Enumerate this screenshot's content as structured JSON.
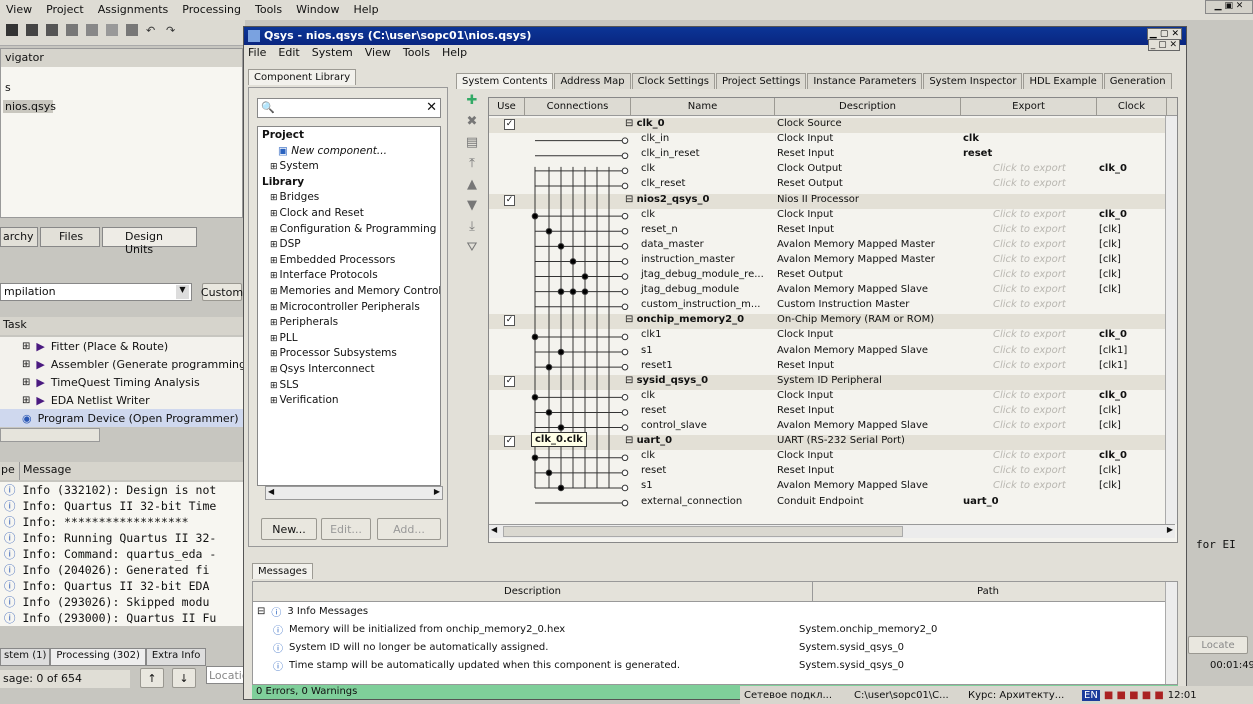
{
  "bg": {
    "menu": [
      "View",
      "Project",
      "Assignments",
      "Processing",
      "Tools",
      "Window",
      "Help"
    ],
    "navigator_label": "vigator",
    "nav_letter": "s",
    "file_item": "nios.qsys",
    "nav_tabs": [
      "archy",
      "Files",
      "Design Units"
    ],
    "compile_select": "mpilation",
    "custom_btn": "Custom",
    "task_header": "Task",
    "tasks": [
      "Fitter (Place & Route)",
      "Assembler (Generate programming fil",
      "TimeQuest Timing Analysis",
      "EDA Netlist Writer",
      "Program Device (Open Programmer)"
    ],
    "msg_col1": "pe",
    "msg_col2": "Message",
    "logs": [
      "Info (332102): Design is not",
      "Info: Quartus II 32-bit Time",
      "Info: ******************",
      "Info: Running Quartus II 32-",
      "Info: Command: quartus_eda -",
      "Info (204026): Generated fi",
      "Info: Quartus II 32-bit EDA",
      "Info (293026): Skipped modu",
      "Info (293000): Quartus II Fu"
    ],
    "bottom_tabs": [
      "stem (1)",
      "Processing (302)",
      "Extra Info"
    ],
    "status": "sage: 0 of 654",
    "location": "Locatio",
    "right_text": "for EI",
    "right_locate": "Locate",
    "right_time": "00:01:49"
  },
  "qsys": {
    "title": "Qsys - nios.qsys (C:\\user\\sopc01\\nios.qsys)",
    "menu": [
      "File",
      "Edit",
      "System",
      "View",
      "Tools",
      "Help"
    ],
    "lib_tab": "Component Library",
    "lib": [
      {
        "t": "Project",
        "b": true,
        "i": 0
      },
      {
        "t": "New component...",
        "i": 2,
        "it": true
      },
      {
        "t": "System",
        "i": 1,
        "p": true
      },
      {
        "t": "Library",
        "b": true,
        "i": 0
      },
      {
        "t": "Bridges",
        "i": 1,
        "p": true
      },
      {
        "t": "Clock and Reset",
        "i": 1,
        "p": true
      },
      {
        "t": "Configuration & Programming",
        "i": 1,
        "p": true
      },
      {
        "t": "DSP",
        "i": 1,
        "p": true
      },
      {
        "t": "Embedded Processors",
        "i": 1,
        "p": true
      },
      {
        "t": "Interface Protocols",
        "i": 1,
        "p": true
      },
      {
        "t": "Memories and Memory Controller",
        "i": 1,
        "p": true
      },
      {
        "t": "Microcontroller Peripherals",
        "i": 1,
        "p": true
      },
      {
        "t": "Peripherals",
        "i": 1,
        "p": true
      },
      {
        "t": "PLL",
        "i": 1,
        "p": true
      },
      {
        "t": "Processor Subsystems",
        "i": 1,
        "p": true
      },
      {
        "t": "Qsys Interconnect",
        "i": 1,
        "p": true
      },
      {
        "t": "SLS",
        "i": 1,
        "p": true
      },
      {
        "t": "Verification",
        "i": 1,
        "p": true
      }
    ],
    "lib_buttons": [
      "New...",
      "Edit...",
      "Add..."
    ],
    "tabs": [
      "System Contents",
      "Address Map",
      "Clock Settings",
      "Project Settings",
      "Instance Parameters",
      "System Inspector",
      "HDL Example",
      "Generation"
    ],
    "cols": [
      "Use",
      "Connections",
      "Name",
      "Description",
      "Export",
      "Clock"
    ],
    "rows": [
      {
        "use": "✓",
        "name": "clk_0",
        "desc": "Clock Source",
        "exp": "",
        "clk": "",
        "top": true
      },
      {
        "name": "clk_in",
        "desc": "Clock Input",
        "exp": "clk",
        "clk": ""
      },
      {
        "name": "clk_in_reset",
        "desc": "Reset Input",
        "exp": "reset",
        "clk": ""
      },
      {
        "name": "clk",
        "desc": "Clock Output",
        "exp": "Click to export",
        "clk": "clk_0"
      },
      {
        "name": "clk_reset",
        "desc": "Reset Output",
        "exp": "Click to export",
        "clk": ""
      },
      {
        "use": "✓",
        "name": "nios2_qsys_0",
        "desc": "Nios II Processor",
        "exp": "",
        "clk": "",
        "top": true
      },
      {
        "name": "clk",
        "desc": "Clock Input",
        "exp": "Click to export",
        "clk": "clk_0"
      },
      {
        "name": "reset_n",
        "desc": "Reset Input",
        "exp": "Click to export",
        "clk": "[clk]"
      },
      {
        "name": "data_master",
        "desc": "Avalon Memory Mapped Master",
        "exp": "Click to export",
        "clk": "[clk]"
      },
      {
        "name": "instruction_master",
        "desc": "Avalon Memory Mapped Master",
        "exp": "Click to export",
        "clk": "[clk]"
      },
      {
        "name": "jtag_debug_module_re...",
        "desc": "Reset Output",
        "exp": "Click to export",
        "clk": "[clk]"
      },
      {
        "name": "jtag_debug_module",
        "desc": "Avalon Memory Mapped Slave",
        "exp": "Click to export",
        "clk": "[clk]"
      },
      {
        "name": "custom_instruction_m...",
        "desc": "Custom Instruction Master",
        "exp": "Click to export",
        "clk": ""
      },
      {
        "use": "✓",
        "name": "onchip_memory2_0",
        "desc": "On-Chip Memory (RAM or ROM)",
        "exp": "",
        "clk": "",
        "top": true
      },
      {
        "name": "clk1",
        "desc": "Clock Input",
        "exp": "Click to export",
        "clk": "clk_0"
      },
      {
        "name": "s1",
        "desc": "Avalon Memory Mapped Slave",
        "exp": "Click to export",
        "clk": "[clk1]"
      },
      {
        "name": "reset1",
        "desc": "Reset Input",
        "exp": "Click to export",
        "clk": "[clk1]"
      },
      {
        "use": "✓",
        "name": "sysid_qsys_0",
        "desc": "System ID Peripheral",
        "exp": "",
        "clk": "",
        "top": true
      },
      {
        "name": "clk",
        "desc": "Clock Input",
        "exp": "Click to export",
        "clk": "clk_0"
      },
      {
        "name": "reset",
        "desc": "Reset Input",
        "exp": "Click to export",
        "clk": "[clk]"
      },
      {
        "name": "control_slave",
        "desc": "Avalon Memory Mapped Slave",
        "exp": "Click to export",
        "clk": "[clk]"
      },
      {
        "use": "✓",
        "name": "uart_0",
        "desc": "UART (RS-232 Serial Port)",
        "exp": "",
        "clk": "",
        "top": true
      },
      {
        "name": "clk",
        "desc": "Clock Input",
        "exp": "Click to export",
        "clk": "clk_0"
      },
      {
        "name": "reset",
        "desc": "Reset Input",
        "exp": "Click to export",
        "clk": "[clk]"
      },
      {
        "name": "s1",
        "desc": "Avalon Memory Mapped Slave",
        "exp": "Click to export",
        "clk": "[clk]"
      },
      {
        "name": "external_connection",
        "desc": "Conduit Endpoint",
        "exp": "uart_0",
        "clk": ""
      }
    ],
    "tooltip": "clk_0.clk",
    "messages_tab": "Messages",
    "msg_cols": [
      "Description",
      "Path"
    ],
    "msg_rows": [
      {
        "d": "3 Info Messages",
        "p": "",
        "group": true
      },
      {
        "d": "Memory will be initialized from onchip_memory2_0.hex",
        "p": "System.onchip_memory2_0"
      },
      {
        "d": "System ID will no longer be automatically assigned.",
        "p": "System.sysid_qsys_0"
      },
      {
        "d": "Time stamp will be automatically updated when this component is generated.",
        "p": "System.sysid_qsys_0"
      }
    ],
    "status": "0 Errors, 0 Warnings"
  },
  "taskbar": {
    "items": [
      "Сетевое подкл...",
      "C:\\user\\sopc01\\C...",
      "Курс: Архитекту..."
    ],
    "lang": "EN",
    "clock": "12:01"
  },
  "colors": {
    "title_bar": "#0a2a8a",
    "grid_bg": "#f4f3ee",
    "top_row": "#e3e0d6",
    "status_green": "#7fcf9a",
    "export_gray": "#b9b7b1"
  }
}
